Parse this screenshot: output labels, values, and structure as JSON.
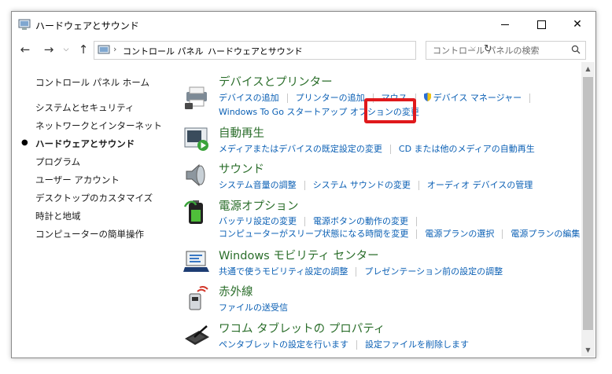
{
  "window": {
    "title": "ハードウェアとサウンド"
  },
  "address": {
    "crumbs": [
      "コントロール パネル",
      "ハードウェアとサウンド"
    ]
  },
  "search": {
    "placeholder": "コントロール パネルの検索"
  },
  "sidebar": {
    "home": "コントロール パネル ホーム",
    "items": [
      {
        "label": "システムとセキュリティ"
      },
      {
        "label": "ネットワークとインターネット"
      },
      {
        "label": "ハードウェアとサウンド",
        "current": true
      },
      {
        "label": "プログラム"
      },
      {
        "label": "ユーザー アカウント"
      },
      {
        "label": "デスクトップのカスタマイズ"
      },
      {
        "label": "時計と地域"
      },
      {
        "label": "コンピューターの簡単操作"
      }
    ]
  },
  "categories": {
    "devices": {
      "title": "デバイスとプリンター",
      "links": [
        "デバイスの追加",
        "プリンターの追加",
        "マウス",
        "デバイス マネージャー"
      ],
      "links2": [
        "Windows To Go スタートアップ オプションの変更"
      ]
    },
    "autoplay": {
      "title": "自動再生",
      "links": [
        "メディアまたはデバイスの既定設定の変更",
        "CD または他のメディアの自動再生"
      ]
    },
    "sound": {
      "title": "サウンド",
      "links": [
        "システム音量の調整",
        "システム サウンドの変更",
        "オーディオ デバイスの管理"
      ]
    },
    "power": {
      "title": "電源オプション",
      "links": [
        "バッテリ設定の変更",
        "電源ボタンの動作の変更"
      ],
      "links2": [
        "コンピューターがスリープ状態になる時間を変更",
        "電源プランの選択",
        "電源プランの編集"
      ]
    },
    "mobility": {
      "title": "Windows モビリティ センター",
      "links": [
        "共通で使うモビリティ設定の調整",
        "プレゼンテーション前の設定の調整"
      ]
    },
    "infrared": {
      "title": "赤外線",
      "links": [
        "ファイルの送受信"
      ]
    },
    "wacom": {
      "title": "ワコム タブレットの プロパティ",
      "links": [
        "ペンタブレットの設定を行います",
        "設定ファイルを削除します"
      ]
    }
  },
  "colors": {
    "highlight": "#e0191c",
    "link": "#0a5fb4",
    "category": "#2b6e2b"
  }
}
